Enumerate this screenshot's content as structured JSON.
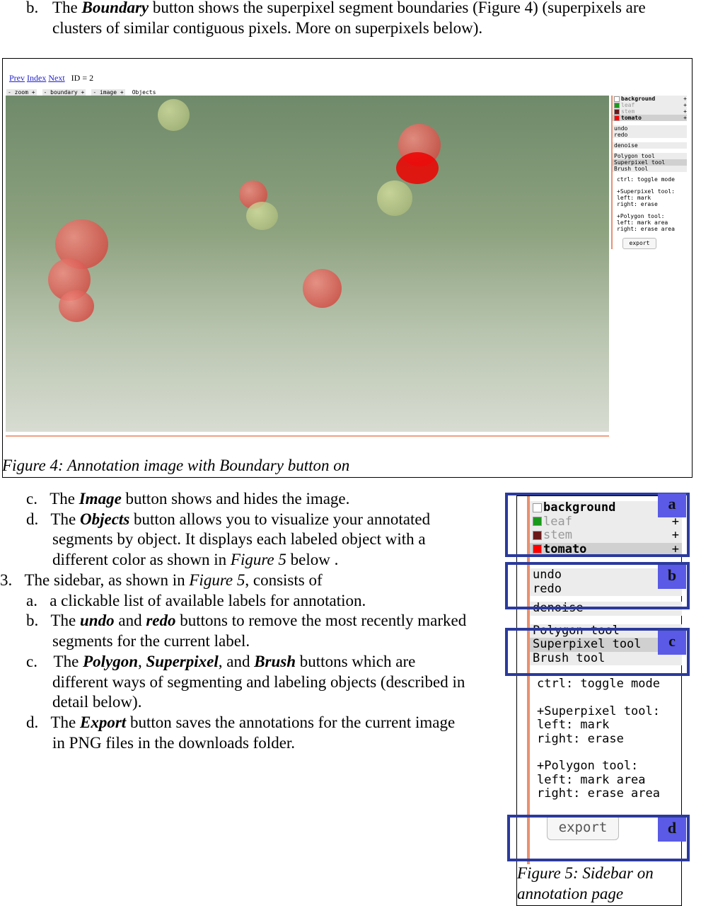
{
  "intro": {
    "marker": "b.",
    "pre": "The ",
    "bold": "Boundary",
    "post": " button shows the superpixel segment boundaries (Figure 4) (superpixels are",
    "line2": "clusters of similar contiguous pixels. More on superpixels below)."
  },
  "figure4": {
    "nav": {
      "prev": "Prev",
      "index": "Index",
      "next": "Next",
      "id": "ID = 2"
    },
    "toolbar": [
      "- zoom +",
      "- boundary +",
      "- image +",
      "Objects"
    ],
    "caption": "Figure 4: Annotation image with Boundary button on"
  },
  "sidebar": {
    "labels": [
      {
        "name": "background",
        "color": "#ffffff",
        "plus": "+"
      },
      {
        "name": "leaf",
        "color": "#1a9a1a",
        "plus": "+"
      },
      {
        "name": "stem",
        "color": "#6b1a1a",
        "plus": "+"
      },
      {
        "name": "tomato",
        "color": "#ff0000",
        "plus": "+"
      }
    ],
    "undo": "undo",
    "redo": "redo",
    "denoise": "denoise",
    "tools": [
      "Polygon tool",
      "Superpixel tool",
      "Brush tool"
    ],
    "help": [
      "ctrl: toggle mode",
      "+Superpixel tool:",
      "left: mark",
      "right: erase",
      "+Polygon tool:",
      "left: mark area",
      "right: erase area"
    ],
    "export": "export"
  },
  "body": [
    {
      "m": "c.",
      "parts": [
        "The ",
        "Image",
        " button shows and hides the image."
      ]
    },
    {
      "m": "d.",
      "parts": [
        "The ",
        "Objects",
        " button allows you to visualize your annotated"
      ]
    },
    {
      "l": "segments by object. It displays each labeled object with a"
    },
    {
      "l": "different color as shown in ",
      "i": "Figure 5",
      " r": " below ."
    },
    {
      "m": "3.",
      "parts": [
        "The sidebar, as shown in ",
        "Figure 5",
        ", consists of"
      ]
    },
    {
      "m": "a.",
      "parts": [
        "a clickable list of available labels for annotation."
      ]
    },
    {
      "m": "b.",
      "parts": [
        "The ",
        "undo",
        " and ",
        "redo",
        " buttons to remove the most recently marked"
      ]
    },
    {
      "l": "segments for the current label."
    },
    {
      "m": "c.",
      "parts": [
        " The ",
        "Polygon",
        ", ",
        "Superpixel",
        ", and ",
        "Brush",
        " buttons which are"
      ]
    },
    {
      "l": "different ways of segmenting and labeling objects (described in"
    },
    {
      "l": "detail below)."
    },
    {
      "m": "d.",
      "parts": [
        "The ",
        "Export",
        " button saves the annotations for the current image"
      ]
    },
    {
      "l": "in PNG files in the downloads folder."
    }
  ],
  "figure5": {
    "callouts": [
      "a",
      "b",
      "c",
      "d"
    ],
    "caption1": "Figure 5: Sidebar on",
    "caption2": "annotation page"
  }
}
